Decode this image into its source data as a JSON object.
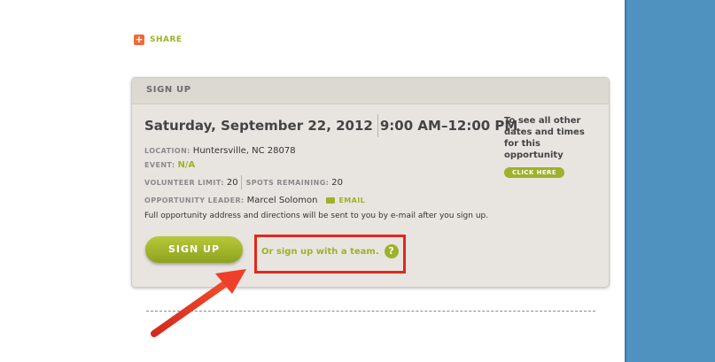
{
  "share": {
    "label": "SHARE",
    "icon": "plus-icon"
  },
  "card": {
    "header": "SIGN UP",
    "date": "Saturday, September 22, 2012",
    "time": "9:00 AM–12:00 PM",
    "location_label": "LOCATION:",
    "location_value": "Huntersville, NC 28078",
    "event_label": "EVENT:",
    "event_value": "N/A",
    "volunteer_limit_label": "VOLUNTEER LIMIT:",
    "volunteer_limit_value": "20",
    "spots_remaining_label": "SPOTS REMAINING:",
    "spots_remaining_value": "20",
    "leader_label": "OPPORTUNITY LEADER:",
    "leader_value": "Marcel Solomon",
    "email_label": "EMAIL",
    "note": "Full opportunity address and directions will be sent to you by e-mail after you sign up.",
    "side_text": "To see all other dates and times for this opportunity",
    "click_here": "CLICK HERE",
    "signup_button": "SIGN UP",
    "team_link": "Or sign up with a team.",
    "help_glyph": "?"
  },
  "colors": {
    "accent_green": "#9db228",
    "right_bar": "#4f92bf",
    "highlight_red": "#e2281b"
  }
}
